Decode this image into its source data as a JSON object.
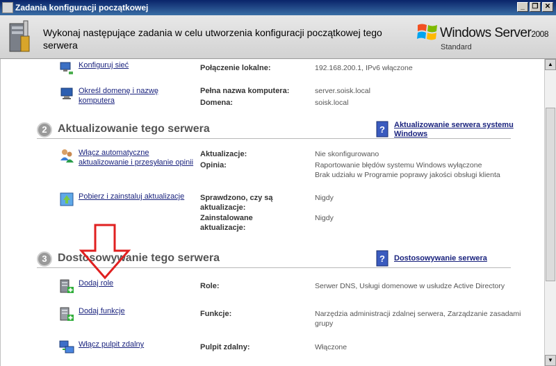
{
  "window": {
    "title": "Zadania konfiguracji początkowej",
    "buttons": {
      "minimize": "_",
      "restore": "❐",
      "close": "✕"
    }
  },
  "header": {
    "description": "Wykonaj następujące zadania w celu utworzenia konfiguracji początkowej tego serwera",
    "brand_name": "Windows Server",
    "brand_version": "2008",
    "brand_edition": "Standard"
  },
  "section1": {
    "tasks": [
      {
        "label": "Konfiguruj sieć",
        "icon": "network-icon"
      },
      {
        "label": "Określ domenę i nazwę komputera",
        "icon": "computer-name-icon"
      }
    ],
    "details": [
      {
        "label": "Połączenie lokalne:",
        "value": "192.168.200.1, IPv6 włączone"
      },
      {
        "label": "Pełna nazwa komputera:",
        "value": "server.soisk.local"
      },
      {
        "label": "Domena:",
        "value": "soisk.local"
      }
    ]
  },
  "section2": {
    "number": "2",
    "title": "Aktualizowanie tego serwera",
    "side_link": "Aktualizowanie serwera systemu Windows",
    "tasks": [
      {
        "label": "Włącz automatyczne aktualizowanie i przesyłanie opinii",
        "icon": "users-icon"
      },
      {
        "label": "Pobierz i zainstaluj aktualizacje",
        "icon": "update-icon"
      }
    ],
    "details": [
      {
        "label": "Aktualizacje:",
        "value": "Nie skonfigurowano"
      },
      {
        "label": "Opinia:",
        "value": "Raportowanie błędów systemu Windows wyłączone"
      },
      {
        "label": "",
        "value": "Brak udziału w Programie poprawy jakości obsługi klienta"
      },
      {
        "label": "Sprawdzono, czy są aktualizacje:",
        "value": "Nigdy"
      },
      {
        "label": "Zainstalowane aktualizacje:",
        "value": "Nigdy"
      }
    ]
  },
  "section3": {
    "number": "3",
    "title": "Dostosowywanie tego serwera",
    "side_link": "Dostosowywanie serwera",
    "tasks": [
      {
        "label": "Dodaj role",
        "icon": "add-role-icon"
      },
      {
        "label": "Dodaj funkcje",
        "icon": "add-feature-icon"
      },
      {
        "label": "Włącz pulpit zdalny",
        "icon": "remote-desktop-icon"
      }
    ],
    "details": [
      {
        "label": "Role:",
        "value": "Serwer DNS, Usługi domenowe w usłudze Active Directory"
      },
      {
        "label": "Funkcje:",
        "value": "Narzędzia administracji zdalnej serwera, Zarządzanie zasadami grupy"
      },
      {
        "label": "Pulpit zdalny:",
        "value": "Włączone"
      }
    ]
  },
  "colors": {
    "link": "#1a237e",
    "annotation_arrow": "#e02020",
    "title_bar": "#0a246a"
  }
}
